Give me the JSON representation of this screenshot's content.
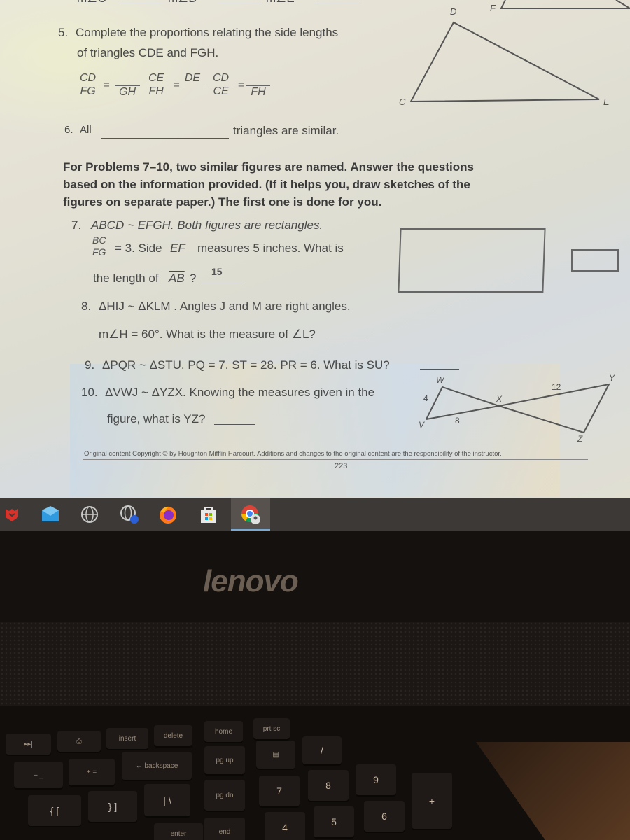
{
  "top_partial": {
    "prefix_1": "m∠C =",
    "prefix_2": "m∠D =",
    "prefix_3": "m∠E ="
  },
  "problem5": {
    "number": "5.",
    "text_line1": "Complete the proportions relating the side lengths",
    "text_line2": "of triangles CDE and FGH.",
    "proportion1": {
      "num1": "CD",
      "den1": "FG",
      "num2": "",
      "den2": "GH"
    },
    "proportion2": {
      "num1": "CE",
      "den1": "FH",
      "num2": "DE",
      "den2": ""
    },
    "proportion3": {
      "num1": "CD",
      "den1": "CE",
      "num2": "",
      "den2": "FH"
    },
    "equals": "="
  },
  "triangle_cde": {
    "labels": {
      "C": "C",
      "D": "D",
      "E": "E",
      "F": "F"
    }
  },
  "problem6": {
    "number": "6.",
    "prefix": "All",
    "suffix": "triangles are similar."
  },
  "instructions": {
    "line1": "For Problems 7–10, two similar figures are named. Answer the questions",
    "line2": "based on the information provided. (If it helps you, draw sketches of the",
    "line3": "figures on separate paper.) The first one is done for you."
  },
  "problem7": {
    "number": "7.",
    "line1": "ABCD ~ EFGH. Both figures are rectangles.",
    "frac_num": "BC",
    "frac_den": "FG",
    "line2_a": "= 3. Side",
    "line2_seg": "EF",
    "line2_b": "measures 5 inches. What is",
    "line3_a": "the length of",
    "line3_seg": "AB",
    "line3_b": "?",
    "answer": "15"
  },
  "problem8": {
    "number": "8.",
    "line1": "ΔHIJ ~ ΔKLM . Angles J and M are right angles.",
    "line2": "m∠H = 60°. What is the measure of ∠L?"
  },
  "problem9": {
    "number": "9.",
    "text": "ΔPQR ~ ΔSTU. PQ = 7. ST = 28. PR = 6. What is SU?"
  },
  "problem10": {
    "number": "10.",
    "line1": "ΔVWJ ~ ΔYZX. Knowing the measures given in the",
    "line2": "figure, what is YZ?"
  },
  "figure10": {
    "labels": {
      "W": "W",
      "V": "V",
      "X": "X",
      "Y": "Y",
      "Z": "Z"
    },
    "measures": {
      "VW": "4",
      "VX": "8",
      "XY": "12"
    }
  },
  "footer": {
    "copyright": "Original content Copyright © by Houghton Mifflin Harcourt. Additions and changes to the original content are the responsibility of the instructor.",
    "page_number": "223"
  },
  "taskbar": {
    "icons": [
      "mcafee-icon",
      "mail-icon",
      "globe-icon",
      "globe-network-icon",
      "firefox-icon",
      "store-icon",
      "chrome-icon"
    ],
    "active": "chrome-icon"
  },
  "laptop": {
    "brand": "lenovo"
  },
  "keyboard": {
    "keys": {
      "prtsc": "prt sc",
      "insert": "insert",
      "delete": "delete",
      "home": "home",
      "backspace": "← backspace",
      "pgup": "pg up",
      "pgdn": "pg dn",
      "end": "end",
      "enter": "enter",
      "n7": "7",
      "n8": "8",
      "n9": "9",
      "n4": "4",
      "n5": "5",
      "n6": "6",
      "slash": "/",
      "plus": "+",
      "brace": "{ [",
      "brace_close": "} ]",
      "pipe": "| \\",
      "equals": "+ =",
      "minus": "– _"
    }
  }
}
